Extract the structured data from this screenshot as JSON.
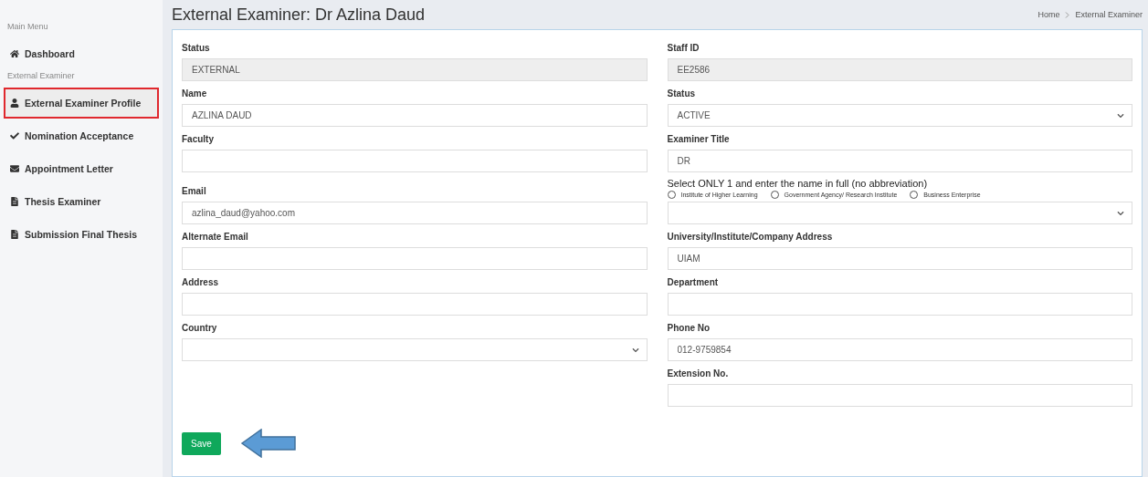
{
  "sidebar": {
    "sections": [
      {
        "heading": "Main Menu",
        "items": [
          {
            "label": "Dashboard",
            "selected": false
          }
        ]
      },
      {
        "heading": "External Examiner",
        "items": [
          {
            "label": "External Examiner Profile",
            "selected": true
          },
          {
            "label": "Nomination Acceptance",
            "selected": false
          },
          {
            "label": "Appointment Letter",
            "selected": false
          },
          {
            "label": "Thesis Examiner",
            "selected": false
          },
          {
            "label": "Submission Final Thesis",
            "selected": false
          }
        ]
      }
    ]
  },
  "page_title": "External Examiner: Dr Azlina Daud",
  "breadcrumb": [
    "Home",
    "External Examiner"
  ],
  "form": {
    "rows": [
      [
        {
          "kind": "text",
          "label": "Status",
          "value": "EXTERNAL",
          "readonly": true
        },
        {
          "kind": "text",
          "label": "Staff ID",
          "value": "EE2586",
          "readonly": true
        }
      ],
      [
        {
          "kind": "text",
          "label": "Name",
          "value": "AZLINA DAUD",
          "readonly": false
        },
        {
          "kind": "select",
          "label": "Status",
          "value": "ACTIVE"
        }
      ],
      [
        {
          "kind": "text",
          "label": "Faculty",
          "readonly": false
        },
        {
          "kind": "text",
          "label": "Examiner Title",
          "value": "DR",
          "readonly": false
        }
      ],
      [
        {
          "kind": "text",
          "label": "Email",
          "value": "azlina_daud@yahoo.com",
          "readonly": false
        },
        {
          "kind": "choice",
          "note": "Select ONLY 1 and enter the name in full (no abbreviation)",
          "options": [
            {
              "label": "Institute of Higher Learning",
              "selected": false
            },
            {
              "label": "Government Agency/ Research Institute",
              "selected": false
            },
            {
              "label": "Business Enterprise",
              "selected": false
            }
          ]
        }
      ],
      [
        {
          "kind": "text",
          "label": "Alternate Email",
          "readonly": false
        },
        {
          "kind": "text",
          "label": "University/Institute/Company Address",
          "value": "UIAM",
          "readonly": false
        }
      ],
      [
        {
          "kind": "text",
          "label": "Address",
          "readonly": false
        },
        {
          "kind": "text",
          "label": "Department",
          "readonly": false
        }
      ],
      [
        {
          "kind": "select",
          "label": "Country"
        },
        {
          "kind": "text",
          "label": "Phone No",
          "value": "012-9759854",
          "readonly": false
        }
      ],
      [
        null,
        {
          "kind": "text",
          "label": "Extension No.",
          "readonly": false
        }
      ]
    ],
    "save_button": "Save"
  }
}
